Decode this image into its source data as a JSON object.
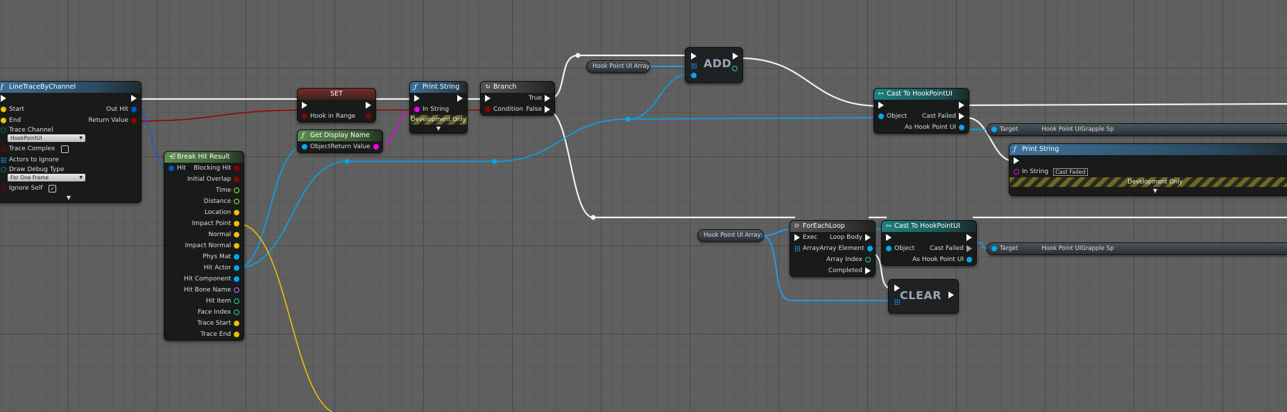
{
  "colors": {
    "exec": "#ffffff",
    "bool": "#8c0000",
    "vector": "#f0c000",
    "float": "#9bf03c",
    "object": "#00a8f0",
    "struct": "#0058c8",
    "string": "#f000f0",
    "int": "#1fe0a0",
    "name": "#c080ff",
    "byte": "#006060",
    "array": "#1aa0ff"
  },
  "nodes": {
    "line_trace": {
      "title": "LineTraceByChannel",
      "icon": "function-icon",
      "style": "func",
      "rows": [
        [
          {
            "type": "exec"
          },
          {
            "type": "exec"
          }
        ],
        [
          {
            "label": "Start",
            "type": "vector"
          },
          {
            "label": "Out Hit",
            "type": "struct"
          }
        ],
        [
          {
            "label": "End",
            "type": "vector"
          },
          {
            "label": "Return Value",
            "type": "bool"
          }
        ],
        [
          {
            "label": "Trace Channel",
            "type": "byte",
            "dropdown": "HookPointUI"
          }
        ],
        [
          {
            "label": "Trace Complex",
            "type": "bool",
            "checkbox": false
          }
        ],
        [
          {
            "label": "Actors to Ignore",
            "type": "array"
          }
        ],
        [
          {
            "label": "Draw Debug Type",
            "type": "byte",
            "dropdown": "For One Frame"
          }
        ],
        [
          {
            "label": "Ignore Self",
            "type": "bool",
            "checkbox": true
          }
        ]
      ],
      "expand": "▼"
    },
    "break_hit": {
      "title": "Break Hit Result",
      "icon": "break-struct-icon",
      "style": "pure",
      "rows": [
        [
          {
            "label": "Hit",
            "type": "struct"
          },
          {
            "label": "Blocking Hit",
            "type": "bool"
          }
        ],
        [
          null,
          {
            "label": "Initial Overlap",
            "type": "bool"
          }
        ],
        [
          null,
          {
            "label": "Time",
            "type": "float"
          }
        ],
        [
          null,
          {
            "label": "Distance",
            "type": "float"
          }
        ],
        [
          null,
          {
            "label": "Location",
            "type": "vector"
          }
        ],
        [
          null,
          {
            "label": "Impact Point",
            "type": "vector"
          }
        ],
        [
          null,
          {
            "label": "Normal",
            "type": "vector"
          }
        ],
        [
          null,
          {
            "label": "Impact Normal",
            "type": "vector"
          }
        ],
        [
          null,
          {
            "label": "Phys Mat",
            "type": "object"
          }
        ],
        [
          null,
          {
            "label": "Hit Actor",
            "type": "object"
          }
        ],
        [
          null,
          {
            "label": "Hit Component",
            "type": "object"
          }
        ],
        [
          null,
          {
            "label": "Hit Bone Name",
            "type": "name"
          }
        ],
        [
          null,
          {
            "label": "Hit Item",
            "type": "int"
          }
        ],
        [
          null,
          {
            "label": "Face Index",
            "type": "int"
          }
        ],
        [
          null,
          {
            "label": "Trace Start",
            "type": "vector"
          }
        ],
        [
          null,
          {
            "label": "Trace End",
            "type": "vector"
          }
        ]
      ]
    },
    "set_node": {
      "title": "SET",
      "style": "set",
      "rows": [
        [
          {
            "type": "exec"
          },
          {
            "type": "exec"
          }
        ],
        [
          {
            "label": "Hook in Range",
            "type": "bool"
          },
          {
            "type": "bool"
          }
        ]
      ]
    },
    "get_display_name": {
      "title": "Get Display Name",
      "icon": "function-icon",
      "style": "pure",
      "rows": [
        [
          {
            "label": "Object",
            "type": "object"
          },
          {
            "label": "Return Value",
            "type": "string"
          }
        ]
      ]
    },
    "print_string_1": {
      "title": "Print String",
      "icon": "function-icon",
      "style": "func",
      "rows": [
        [
          {
            "type": "exec"
          },
          {
            "type": "exec"
          }
        ],
        [
          {
            "label": "In String",
            "type": "string"
          }
        ]
      ],
      "dev": "Development Only",
      "expand": "▼"
    },
    "branch": {
      "title": "Branch",
      "icon": "branch-icon",
      "style": "branch",
      "rows": [
        [
          {
            "type": "exec"
          },
          {
            "label": "True",
            "type": "exec"
          }
        ],
        [
          {
            "label": "Condition",
            "type": "bool"
          },
          {
            "label": "False",
            "type": "exec"
          }
        ]
      ]
    },
    "cast_1": {
      "title": "Cast To HookPointUI",
      "icon": "cast-icon",
      "style": "cast",
      "rows": [
        [
          {
            "type": "exec"
          },
          {
            "type": "exec"
          }
        ],
        [
          {
            "label": "Object",
            "type": "object"
          },
          {
            "label": "Cast Failed",
            "type": "exec"
          }
        ],
        [
          null,
          {
            "label": "As Hook Point UI",
            "type": "object"
          }
        ]
      ]
    },
    "print_string_2": {
      "title": "Print String",
      "icon": "function-icon",
      "style": "func",
      "rows": [
        [
          {
            "type": "exec"
          },
          null
        ],
        [
          {
            "label": "In String",
            "type": "string",
            "value": "Cast Failed",
            "hollow": true
          }
        ]
      ],
      "dev": "Development Only",
      "expand": "▼"
    },
    "for_each": {
      "title": "ForEachLoop",
      "icon": "loop-icon",
      "style": "branch",
      "rows": [
        [
          {
            "label": "Exec",
            "type": "exec"
          },
          {
            "label": "Loop Body",
            "type": "exec"
          }
        ],
        [
          {
            "label": "Array",
            "type": "array"
          },
          {
            "label": "Array Element",
            "type": "object"
          }
        ],
        [
          null,
          {
            "label": "Array Index",
            "type": "int",
            "hollow": true
          }
        ],
        [
          null,
          {
            "label": "Completed",
            "type": "exec"
          }
        ]
      ]
    },
    "cast_2": {
      "title": "Cast To HookPointUI",
      "icon": "cast-icon",
      "style": "cast",
      "rows": [
        [
          {
            "type": "exec"
          },
          {
            "type": "exec"
          }
        ],
        [
          {
            "label": "Object",
            "type": "object"
          },
          {
            "label": "Cast Failed",
            "type": "exec",
            "hollow": true
          }
        ],
        [
          null,
          {
            "label": "As Hook Point UI",
            "type": "object"
          }
        ]
      ]
    }
  },
  "getters": {
    "array_getter_1": {
      "label": "Hook Point UI Array"
    },
    "array_getter_2": {
      "label": "Hook Point UI Array"
    },
    "target_1": {
      "label": "Target",
      "value": "Hook Point UIGrapple Sp"
    },
    "target_2": {
      "label": "Target",
      "value": "Hook Point UIGrapple Sp"
    }
  },
  "compact": {
    "add": {
      "label": "ADD"
    },
    "clear": {
      "label": "CLEAR"
    }
  }
}
